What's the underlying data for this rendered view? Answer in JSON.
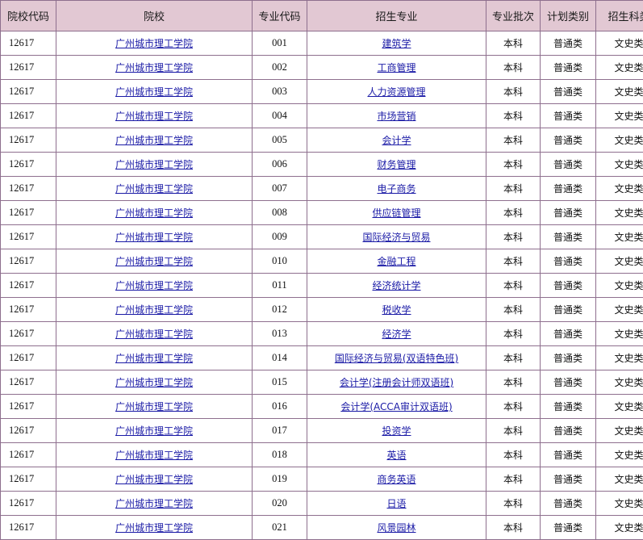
{
  "colors": {
    "header_bg": "#e2c8d3",
    "border": "#8e6f8e",
    "link": "#1a1aa6"
  },
  "headers": [
    "院校代码",
    "院校",
    "专业代码",
    "招生专业",
    "专业批次",
    "计划类别",
    "招生科类"
  ],
  "rows": [
    {
      "school_code": "12617",
      "school": "广州城市理工学院",
      "major_code": "001",
      "major": "建筑学",
      "batch": "本科",
      "plan": "普通类",
      "subject": "文史类"
    },
    {
      "school_code": "12617",
      "school": "广州城市理工学院",
      "major_code": "002",
      "major": "工商管理",
      "batch": "本科",
      "plan": "普通类",
      "subject": "文史类"
    },
    {
      "school_code": "12617",
      "school": "广州城市理工学院",
      "major_code": "003",
      "major": "人力资源管理",
      "batch": "本科",
      "plan": "普通类",
      "subject": "文史类"
    },
    {
      "school_code": "12617",
      "school": "广州城市理工学院",
      "major_code": "004",
      "major": "市场营销",
      "batch": "本科",
      "plan": "普通类",
      "subject": "文史类"
    },
    {
      "school_code": "12617",
      "school": "广州城市理工学院",
      "major_code": "005",
      "major": "会计学",
      "batch": "本科",
      "plan": "普通类",
      "subject": "文史类"
    },
    {
      "school_code": "12617",
      "school": "广州城市理工学院",
      "major_code": "006",
      "major": "财务管理",
      "batch": "本科",
      "plan": "普通类",
      "subject": "文史类"
    },
    {
      "school_code": "12617",
      "school": "广州城市理工学院",
      "major_code": "007",
      "major": "电子商务",
      "batch": "本科",
      "plan": "普通类",
      "subject": "文史类"
    },
    {
      "school_code": "12617",
      "school": "广州城市理工学院",
      "major_code": "008",
      "major": "供应链管理",
      "batch": "本科",
      "plan": "普通类",
      "subject": "文史类"
    },
    {
      "school_code": "12617",
      "school": "广州城市理工学院",
      "major_code": "009",
      "major": "国际经济与贸易",
      "batch": "本科",
      "plan": "普通类",
      "subject": "文史类"
    },
    {
      "school_code": "12617",
      "school": "广州城市理工学院",
      "major_code": "010",
      "major": "金融工程",
      "batch": "本科",
      "plan": "普通类",
      "subject": "文史类"
    },
    {
      "school_code": "12617",
      "school": "广州城市理工学院",
      "major_code": "011",
      "major": "经济统计学",
      "batch": "本科",
      "plan": "普通类",
      "subject": "文史类"
    },
    {
      "school_code": "12617",
      "school": "广州城市理工学院",
      "major_code": "012",
      "major": "税收学",
      "batch": "本科",
      "plan": "普通类",
      "subject": "文史类"
    },
    {
      "school_code": "12617",
      "school": "广州城市理工学院",
      "major_code": "013",
      "major": "经济学",
      "batch": "本科",
      "plan": "普通类",
      "subject": "文史类"
    },
    {
      "school_code": "12617",
      "school": "广州城市理工学院",
      "major_code": "014",
      "major": "国际经济与贸易(双语特色班)",
      "batch": "本科",
      "plan": "普通类",
      "subject": "文史类"
    },
    {
      "school_code": "12617",
      "school": "广州城市理工学院",
      "major_code": "015",
      "major": "会计学(注册会计师双语班)",
      "batch": "本科",
      "plan": "普通类",
      "subject": "文史类"
    },
    {
      "school_code": "12617",
      "school": "广州城市理工学院",
      "major_code": "016",
      "major": "会计学(ACCA审计双语班)",
      "batch": "本科",
      "plan": "普通类",
      "subject": "文史类"
    },
    {
      "school_code": "12617",
      "school": "广州城市理工学院",
      "major_code": "017",
      "major": "投资学",
      "batch": "本科",
      "plan": "普通类",
      "subject": "文史类"
    },
    {
      "school_code": "12617",
      "school": "广州城市理工学院",
      "major_code": "018",
      "major": "英语",
      "batch": "本科",
      "plan": "普通类",
      "subject": "文史类"
    },
    {
      "school_code": "12617",
      "school": "广州城市理工学院",
      "major_code": "019",
      "major": "商务英语",
      "batch": "本科",
      "plan": "普通类",
      "subject": "文史类"
    },
    {
      "school_code": "12617",
      "school": "广州城市理工学院",
      "major_code": "020",
      "major": "日语",
      "batch": "本科",
      "plan": "普通类",
      "subject": "文史类"
    },
    {
      "school_code": "12617",
      "school": "广州城市理工学院",
      "major_code": "021",
      "major": "风景园林",
      "batch": "本科",
      "plan": "普通类",
      "subject": "文史类"
    }
  ]
}
